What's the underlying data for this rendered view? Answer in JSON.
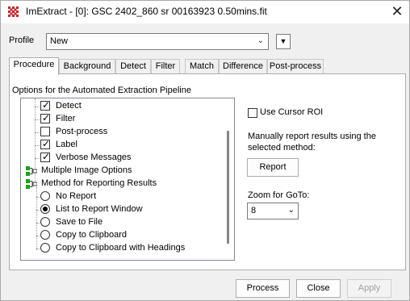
{
  "window": {
    "title": "ImExtract - [0]: GSC 2402_860 sr 00163923 0.50mins.fit",
    "app_icon": "imextract-grid-icon",
    "close_glyph": "✕"
  },
  "profile": {
    "label": "Profile",
    "value": "New",
    "menu_glyph": "▼"
  },
  "tabs": [
    {
      "label": "Procedure",
      "active": true
    },
    {
      "label": "Background",
      "active": false
    },
    {
      "label": "Detect",
      "active": false
    },
    {
      "label": "Filter",
      "active": false
    },
    {
      "label": "Match",
      "active": false
    },
    {
      "label": "Difference",
      "active": false
    },
    {
      "label": "Post-process",
      "active": false
    }
  ],
  "procedure": {
    "group_title": "Options for the Automated Extraction Pipeline",
    "tree": [
      {
        "kind": "checkbox",
        "label": "Detect",
        "checked": true
      },
      {
        "kind": "checkbox",
        "label": "Filter",
        "checked": true
      },
      {
        "kind": "checkbox",
        "label": "Post-process",
        "checked": false
      },
      {
        "kind": "checkbox",
        "label": "Label",
        "checked": true
      },
      {
        "kind": "checkbox",
        "label": "Verbose Messages",
        "checked": true
      },
      {
        "kind": "node",
        "label": "Multiple Image Options"
      },
      {
        "kind": "node",
        "label": "Method for Reporting Results"
      },
      {
        "kind": "radio",
        "label": "No Report",
        "checked": false
      },
      {
        "kind": "radio",
        "label": "List to Report Window",
        "checked": true
      },
      {
        "kind": "radio",
        "label": "Save to File",
        "checked": false
      },
      {
        "kind": "radio",
        "label": "Copy to Clipboard",
        "checked": false
      },
      {
        "kind": "radio",
        "label": "Copy to Clipboard with Headings",
        "checked": false
      }
    ],
    "use_cursor_roi": {
      "label": "Use Cursor ROI",
      "checked": false
    },
    "manual_report_text": "Manually report results using the selected method:",
    "report_button": "Report",
    "zoom_label": "Zoom for GoTo:",
    "zoom_value": "8"
  },
  "footer": {
    "process_label": "Process",
    "close_label": "Close",
    "apply_label": "Apply"
  },
  "colors": {
    "node_icon_green": "#1aa31a",
    "title_icon_red": "#c0282d"
  }
}
